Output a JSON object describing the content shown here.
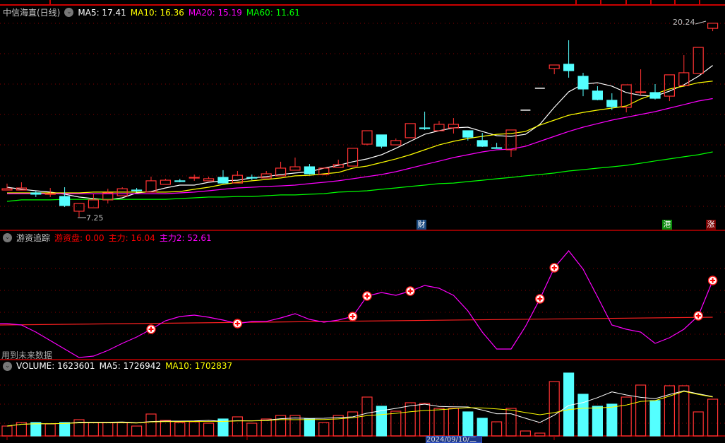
{
  "main_legend": {
    "title": "中信海直(日线)",
    "ma5": "MA5: 17.41",
    "ma10": "MA10: 16.36",
    "ma20": "MA20: 15.19",
    "ma60": "MA60: 11.61"
  },
  "indicator_legend": {
    "title": "游资追踪",
    "youzi": "游资盘: 0.00",
    "zhuli": "主力: 16.04",
    "zhuli2": "主力2: 52.61"
  },
  "indicator_note": "用到未来数据",
  "volume_legend": {
    "volume": "VOLUME: 1623601",
    "ma5": "MA5: 1726942",
    "ma10": "MA10: 1702837"
  },
  "markers": {
    "high_label": "20.24",
    "low_label": "7.25",
    "tag_cai": "财",
    "tag_gang": "港",
    "tag_zhang": "涨"
  },
  "cursor_date": "2024/09/10/二",
  "colors": {
    "up": "#ff3232",
    "down": "#54ffff",
    "ma5": "#ffffff",
    "ma10": "#ffff00",
    "ma20": "#ff00ff",
    "ma60": "#00ff00",
    "grid": "#8b0000",
    "separator": "#c00000"
  },
  "chart_data": [
    {
      "type": "candlestick",
      "title": "中信海直(日线)",
      "high": 20.24,
      "low": 7.25,
      "grid": true,
      "ohlc": [
        [
          9.05,
          9.48,
          9.05,
          9.14
        ],
        [
          9.05,
          9.57,
          9.05,
          9.19
        ],
        [
          8.86,
          9.0,
          8.58,
          8.77
        ],
        [
          8.77,
          9.19,
          8.58,
          8.81
        ],
        [
          8.62,
          9.24,
          7.91,
          8.01
        ],
        [
          7.63,
          8.15,
          7.25,
          8.15
        ],
        [
          7.86,
          8.77,
          7.86,
          8.39
        ],
        [
          8.39,
          9.14,
          8.15,
          8.86
        ],
        [
          8.67,
          9.24,
          8.67,
          9.14
        ],
        [
          9.05,
          9.19,
          8.91,
          9.05
        ],
        [
          8.91,
          9.95,
          8.91,
          9.67
        ],
        [
          9.43,
          9.81,
          9.43,
          9.71
        ],
        [
          9.67,
          9.81,
          9.57,
          9.67
        ],
        [
          9.9,
          10.09,
          9.67,
          9.9
        ],
        [
          9.67,
          9.95,
          9.67,
          9.81
        ],
        [
          9.9,
          10.38,
          9.48,
          9.52
        ],
        [
          9.52,
          10.33,
          9.52,
          10.04
        ],
        [
          9.9,
          10.09,
          9.71,
          9.9
        ],
        [
          9.86,
          10.33,
          9.86,
          10.14
        ],
        [
          10.0,
          10.95,
          10.0,
          10.52
        ],
        [
          10.38,
          11.23,
          10.38,
          10.61
        ],
        [
          10.61,
          10.8,
          10.09,
          10.14
        ],
        [
          10.09,
          10.57,
          10.04,
          10.52
        ],
        [
          10.57,
          11.09,
          10.57,
          10.76
        ],
        [
          10.66,
          11.85,
          10.66,
          11.85
        ],
        [
          12.13,
          13.03,
          12.04,
          13.03
        ],
        [
          12.75,
          12.75,
          11.85,
          11.99
        ],
        [
          12.08,
          12.51,
          12.08,
          12.37
        ],
        [
          12.56,
          13.51,
          12.56,
          13.51
        ],
        [
          13.22,
          14.31,
          13.08,
          13.22
        ],
        [
          13.03,
          13.69,
          13.03,
          13.46
        ],
        [
          13.22,
          13.88,
          12.84,
          13.46
        ],
        [
          13.03,
          13.03,
          12.37,
          12.6
        ],
        [
          12.37,
          12.89,
          11.94,
          11.99
        ],
        [
          11.89,
          12.22,
          11.89,
          11.89
        ],
        [
          11.75,
          13.08,
          11.28,
          13.08
        ],
        [
          14.41,
          14.41,
          14.41,
          14.41
        ],
        [
          15.88,
          15.88,
          15.88,
          15.88
        ],
        [
          17.2,
          17.44,
          16.82,
          17.44
        ],
        [
          17.49,
          19.1,
          16.59,
          17.06
        ],
        [
          16.68,
          16.92,
          15.35,
          15.83
        ],
        [
          15.69,
          16.02,
          15.07,
          15.12
        ],
        [
          15.07,
          15.54,
          14.41,
          14.64
        ],
        [
          14.6,
          16.11,
          14.26,
          16.11
        ],
        [
          15.59,
          17.15,
          15.4,
          15.64
        ],
        [
          15.59,
          16.16,
          15.12,
          15.21
        ],
        [
          15.35,
          16.78,
          15.02,
          16.78
        ],
        [
          16.06,
          18.1,
          16.06,
          16.92
        ],
        [
          16.87,
          18.62,
          16.87,
          18.62
        ],
        [
          19.9,
          20.24,
          19.71,
          20.24
        ]
      ],
      "series": [
        {
          "name": "MA5",
          "values": [
            9.24,
            9.1,
            9.0,
            8.91,
            8.77,
            8.58,
            8.48,
            8.39,
            8.53,
            8.86,
            8.95,
            9.19,
            9.38,
            9.38,
            9.57,
            9.67,
            9.71,
            9.86,
            9.95,
            10.09,
            10.19,
            10.28,
            10.52,
            10.71,
            10.95,
            11.14,
            11.42,
            11.85,
            12.32,
            12.79,
            13.03,
            13.22,
            13.27,
            12.98,
            12.7,
            12.65,
            12.79,
            13.46,
            14.6,
            15.64,
            16.16,
            16.25,
            16.02,
            15.59,
            15.4,
            15.35,
            15.69,
            16.11,
            16.68,
            17.41
          ]
        },
        {
          "name": "MA10",
          "values": [
            8.86,
            8.86,
            8.86,
            8.86,
            8.86,
            8.86,
            8.91,
            8.91,
            8.91,
            8.91,
            8.91,
            8.91,
            8.95,
            9.1,
            9.24,
            9.43,
            9.57,
            9.67,
            9.76,
            9.86,
            10.0,
            10.04,
            10.14,
            10.23,
            10.52,
            10.66,
            10.9,
            11.14,
            11.42,
            11.75,
            12.08,
            12.32,
            12.51,
            12.65,
            12.79,
            12.84,
            12.98,
            13.41,
            13.74,
            14.07,
            14.26,
            14.41,
            14.55,
            14.69,
            15.16,
            15.5,
            15.83,
            16.02,
            16.25,
            16.36
          ]
        },
        {
          "name": "MA20",
          "values": [
            8.81,
            8.81,
            8.81,
            8.81,
            8.81,
            8.81,
            8.81,
            8.81,
            8.81,
            8.81,
            8.81,
            8.81,
            8.86,
            8.91,
            9.0,
            9.1,
            9.19,
            9.24,
            9.29,
            9.33,
            9.38,
            9.48,
            9.57,
            9.67,
            9.81,
            9.95,
            10.09,
            10.28,
            10.52,
            10.76,
            10.99,
            11.23,
            11.42,
            11.61,
            11.75,
            11.8,
            11.99,
            12.32,
            12.65,
            12.98,
            13.27,
            13.51,
            13.74,
            13.93,
            14.12,
            14.31,
            14.55,
            14.78,
            15.02,
            15.19
          ]
        },
        {
          "name": "MA60",
          "values": [
            8.29,
            8.39,
            8.39,
            8.39,
            8.43,
            8.43,
            8.43,
            8.43,
            8.43,
            8.43,
            8.43,
            8.43,
            8.48,
            8.53,
            8.58,
            8.58,
            8.62,
            8.62,
            8.67,
            8.72,
            8.72,
            8.77,
            8.81,
            8.91,
            8.95,
            9.0,
            9.1,
            9.19,
            9.29,
            9.38,
            9.48,
            9.52,
            9.62,
            9.71,
            9.81,
            9.9,
            10.0,
            10.09,
            10.19,
            10.33,
            10.42,
            10.52,
            10.61,
            10.71,
            10.85,
            11.0,
            11.14,
            11.28,
            11.42,
            11.61
          ]
        }
      ]
    },
    {
      "type": "line",
      "title": "游资追踪",
      "series": [
        {
          "name": "主力2",
          "values": [
            9.71,
            8.31,
            1.28,
            -7.16,
            -15.6,
            -24.0,
            -22.6,
            -17.0,
            -9.97,
            -3.64,
            4.09,
            12.52,
            16.74,
            18.15,
            16.04,
            13.23,
            9.71,
            11.82,
            11.82,
            15.34,
            19.56,
            13.93,
            11.12,
            13.23,
            16.74,
            37.13,
            40.65,
            37.83,
            42.05,
            47.68,
            44.86,
            37.83,
            22.37,
            1.28,
            -15.6,
            -15.6,
            6.9,
            34.32,
            65.25,
            82.12,
            63.84,
            36.43,
            8.31,
            4.09,
            1.28,
            -9.97,
            -4.35,
            4.09,
            17.45,
            52.61
          ]
        },
        {
          "name": "主力",
          "start": 8.31,
          "end": 16.04
        }
      ],
      "signal_indices": [
        10,
        16,
        24,
        25,
        28,
        37,
        38,
        48,
        49
      ]
    },
    {
      "type": "bar",
      "title": "VOLUME",
      "values": [
        437000,
        593000,
        593000,
        531000,
        593000,
        718000,
        593000,
        593000,
        593000,
        437000,
        968000,
        687000,
        593000,
        624000,
        562000,
        749000,
        843000,
        562000,
        749000,
        905000,
        905000,
        749000,
        593000,
        905000,
        1062000,
        1717000,
        1311000,
        1093000,
        1467000,
        1436000,
        1218000,
        1218000,
        1062000,
        781000,
        624000,
        1218000,
        219000,
        125000,
        2404000,
        2779000,
        1842000,
        1311000,
        1405000,
        1717000,
        2248000,
        1561000,
        2217000,
        2217000,
        1062000,
        1623601
      ],
      "series": [
        {
          "name": "MA5"
        },
        {
          "name": "MA10"
        }
      ]
    }
  ]
}
